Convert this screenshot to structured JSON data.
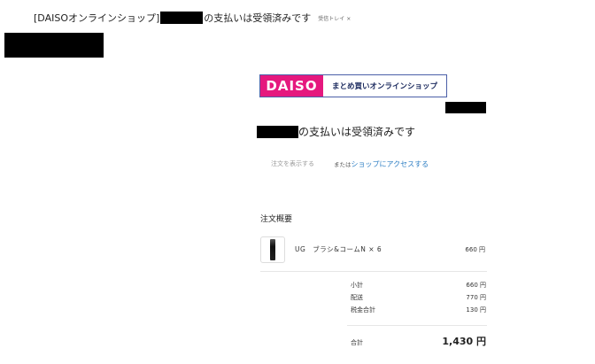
{
  "email": {
    "subject_prefix": "[DAISOオンラインショップ]",
    "subject_suffix": "の支払いは受領済みです",
    "inbox_tag": "受信トレイ ×"
  },
  "logo": {
    "brand": "DAISO",
    "tagline": "まとめ買いオンラインショップ"
  },
  "heading": {
    "suffix": "の支払いは受領済みです"
  },
  "actions": {
    "view_order": "注文を表示する",
    "or_text": "または",
    "shop_link": "ショップにアクセスする"
  },
  "summary": {
    "title": "注文概要",
    "items": [
      {
        "name": "UG　ブラシ&コームN × 6",
        "price": "660 円"
      }
    ],
    "subtotal_label": "小計",
    "subtotal_value": "660 円",
    "shipping_label": "配送",
    "shipping_value": "770 円",
    "tax_label": "税金合計",
    "tax_value": "130 円",
    "total_label": "合計",
    "total_value": "1,430 円"
  },
  "colors": {
    "brand_pink": "#e5187e",
    "link_blue": "#2f7fc4",
    "logo_border": "#4b5fa8"
  }
}
